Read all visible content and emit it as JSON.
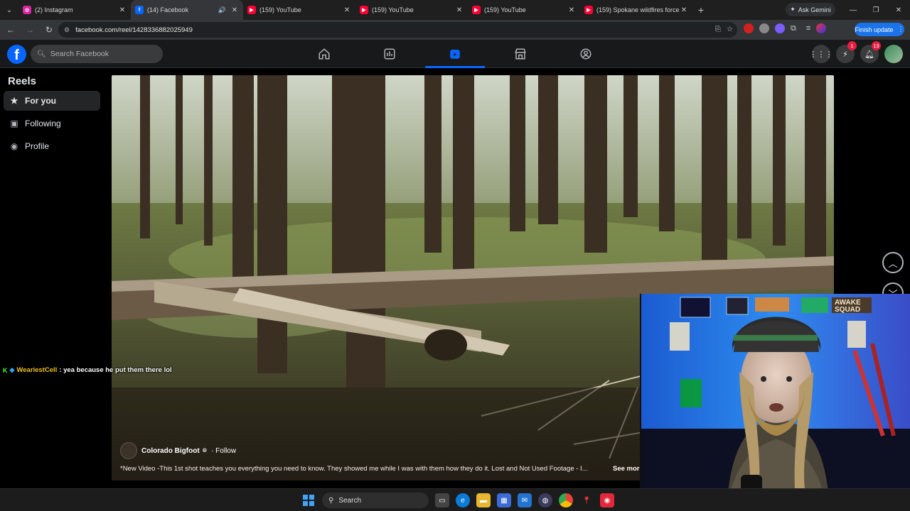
{
  "browser": {
    "tabs": [
      {
        "title": "(2) Instagram",
        "favicon": "instagram-icon",
        "color": "#d6249f",
        "active": false
      },
      {
        "title": "(14) Facebook",
        "favicon": "facebook-icon",
        "color": "#0866ff",
        "active": true
      },
      {
        "title": "(159) YouTube",
        "favicon": "youtube-icon",
        "color": "#ff0033",
        "active": false
      },
      {
        "title": "(159) YouTube",
        "favicon": "youtube-icon",
        "color": "#ff0033",
        "active": false
      },
      {
        "title": "(159) YouTube",
        "favicon": "youtube-icon",
        "color": "#ff0033",
        "active": false
      },
      {
        "title": "(159) Spokane wildfires force th",
        "favicon": "youtube-icon",
        "color": "#ff0033",
        "active": false
      }
    ],
    "ask_gemini": "Ask Gemini",
    "url": "facebook.com/reel/1428336882025949",
    "finish_update": "Finish update"
  },
  "facebook": {
    "search_placeholder": "Search Facebook",
    "nav": [
      "home-icon",
      "video-icon",
      "reels-icon",
      "marketplace-icon",
      "groups-icon"
    ],
    "messenger_badge": "1",
    "notifications_badge": "13",
    "accent": "#0866ff"
  },
  "sidebar": {
    "title": "Reels",
    "items": [
      {
        "label": "For you",
        "icon": "star-icon"
      },
      {
        "label": "Following",
        "icon": "following-icon"
      },
      {
        "label": "Profile",
        "icon": "profile-icon"
      }
    ]
  },
  "reel": {
    "author": "Colorado Bigfoot",
    "follow": "· Follow",
    "caption": "*New Video -This 1st shot teaches you everything you need to know. They showed me while I was with them how they do it.  Lost and Not Used Footage - I...",
    "see_more": "See more"
  },
  "chat": {
    "username": "WeariestCell",
    "message": ": yea because he put them there lol"
  },
  "webcam": {
    "sign_text": "AWAKE SQUAD"
  },
  "taskbar": {
    "search_label": "Search"
  }
}
